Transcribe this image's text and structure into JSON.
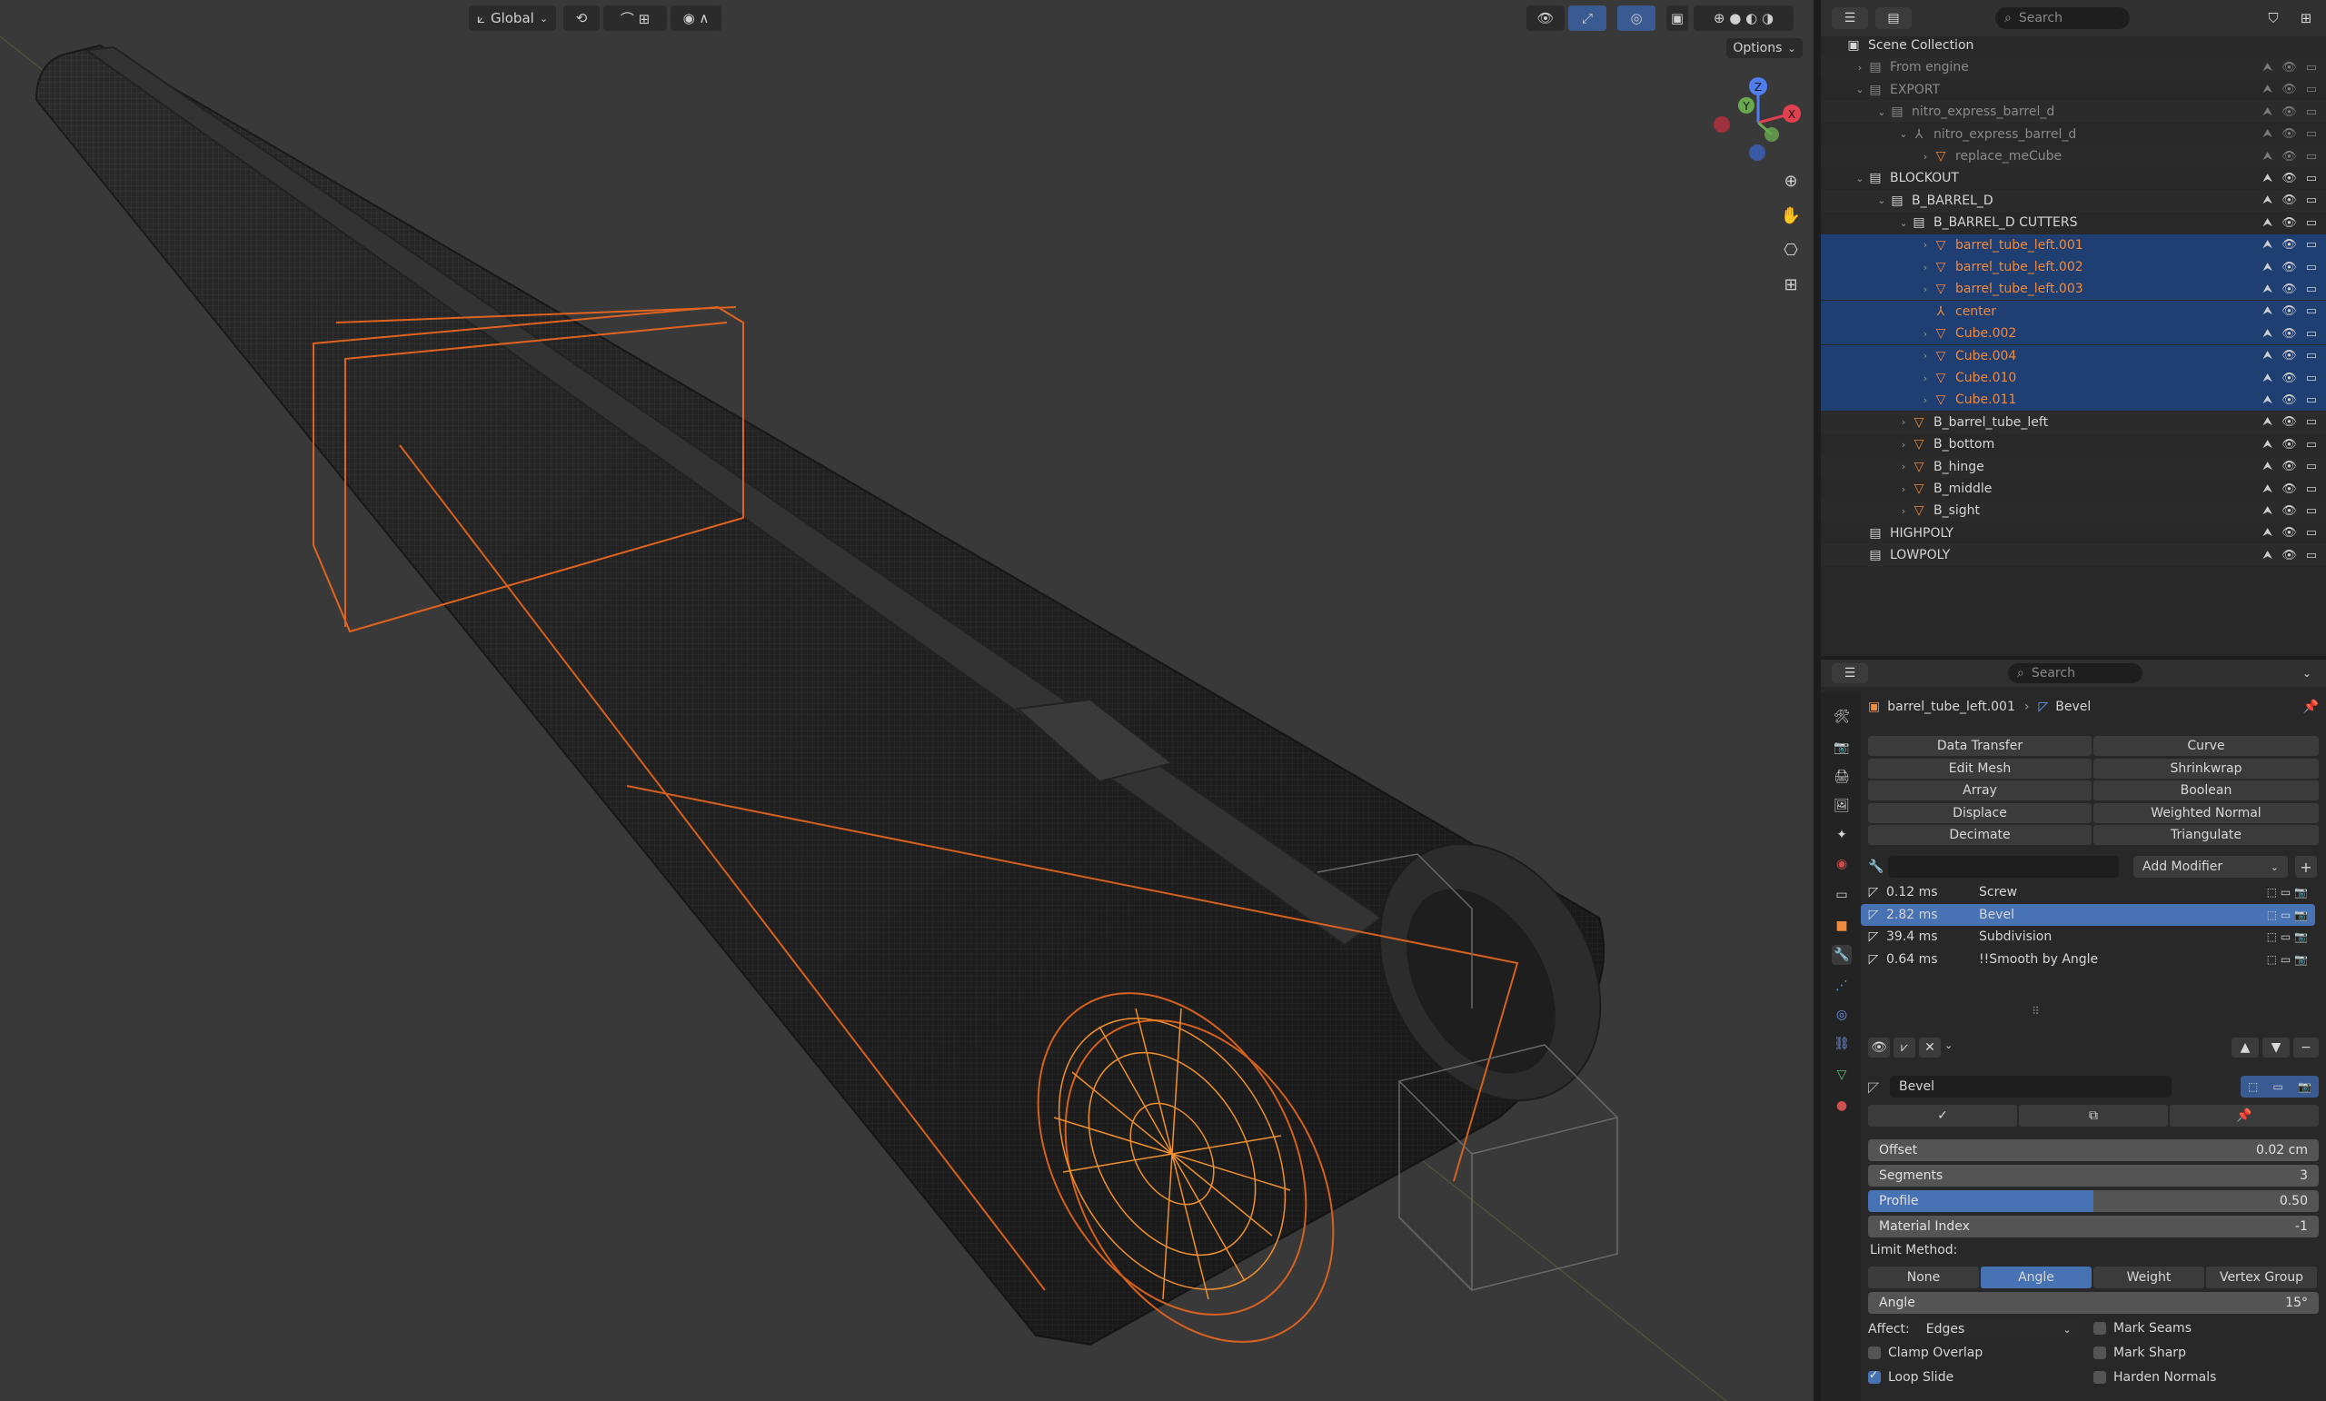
{
  "viewport_header": {
    "transform_orientation": "Global",
    "options_label": "Options"
  },
  "gizmo": {
    "x": "X",
    "y": "Y",
    "z": "Z"
  },
  "outliner": {
    "search_placeholder": "Search",
    "rows": [
      {
        "label": "Scene Collection",
        "indent": 0,
        "icon": "scene-collection-icon",
        "color": "#d6d6d6",
        "sel": false,
        "tri": ""
      },
      {
        "label": "From engine",
        "indent": 1,
        "icon": "collection-icon",
        "color": "#8a8a8a",
        "sel": false,
        "tri": "›"
      },
      {
        "label": "EXPORT",
        "indent": 1,
        "icon": "collection-icon",
        "color": "#8a8a8a",
        "sel": false,
        "tri": "⌄"
      },
      {
        "label": "nitro_express_barrel_d",
        "indent": 2,
        "icon": "collection-icon",
        "color": "#8a8a8a",
        "sel": false,
        "tri": "⌄"
      },
      {
        "label": "nitro_express_barrel_d",
        "indent": 3,
        "icon": "empty-icon",
        "color": "#8a8a8a",
        "sel": false,
        "tri": "⌄"
      },
      {
        "label": "replace_meCube",
        "indent": 4,
        "icon": "mesh-icon",
        "color": "#8a8a8a",
        "sel": false,
        "tri": "›"
      },
      {
        "label": "BLOCKOUT",
        "indent": 1,
        "icon": "collection-icon",
        "color": "#d6d6d6",
        "sel": false,
        "tri": "⌄"
      },
      {
        "label": "B_BARREL_D",
        "indent": 2,
        "icon": "collection-icon",
        "color": "#d6d6d6",
        "sel": false,
        "tri": "⌄"
      },
      {
        "label": "B_BARREL_D CUTTERS",
        "indent": 3,
        "icon": "collection-icon",
        "color": "#d6d6d6",
        "sel": false,
        "tri": "⌄"
      },
      {
        "label": "barrel_tube_left.001",
        "indent": 4,
        "icon": "mesh-icon",
        "color": "#f08a3c",
        "sel": true,
        "tri": "›"
      },
      {
        "label": "barrel_tube_left.002",
        "indent": 4,
        "icon": "mesh-icon",
        "color": "#f08a3c",
        "sel": true,
        "tri": "›"
      },
      {
        "label": "barrel_tube_left.003",
        "indent": 4,
        "icon": "mesh-icon",
        "color": "#f08a3c",
        "sel": true,
        "tri": "›"
      },
      {
        "label": "center",
        "indent": 4,
        "icon": "empty-icon",
        "color": "#f08a3c",
        "sel": true,
        "tri": ""
      },
      {
        "label": "Cube.002",
        "indent": 4,
        "icon": "mesh-icon",
        "color": "#f08a3c",
        "sel": true,
        "tri": "›"
      },
      {
        "label": "Cube.004",
        "indent": 4,
        "icon": "mesh-icon",
        "color": "#f08a3c",
        "sel": true,
        "tri": "›"
      },
      {
        "label": "Cube.010",
        "indent": 4,
        "icon": "mesh-icon",
        "color": "#f08a3c",
        "sel": true,
        "tri": "›"
      },
      {
        "label": "Cube.011",
        "indent": 4,
        "icon": "mesh-icon",
        "color": "#f08a3c",
        "sel": true,
        "tri": "›"
      },
      {
        "label": "B_barrel_tube_left",
        "indent": 3,
        "icon": "mesh-icon",
        "color": "#d6d6d6",
        "sel": false,
        "tri": "›"
      },
      {
        "label": "B_bottom",
        "indent": 3,
        "icon": "mesh-icon",
        "color": "#d6d6d6",
        "sel": false,
        "tri": "›"
      },
      {
        "label": "B_hinge",
        "indent": 3,
        "icon": "mesh-icon",
        "color": "#d6d6d6",
        "sel": false,
        "tri": "›"
      },
      {
        "label": "B_middle",
        "indent": 3,
        "icon": "mesh-icon",
        "color": "#d6d6d6",
        "sel": false,
        "tri": "›"
      },
      {
        "label": "B_sight",
        "indent": 3,
        "icon": "mesh-icon",
        "color": "#d6d6d6",
        "sel": false,
        "tri": "›"
      },
      {
        "label": "HIGHPOLY",
        "indent": 1,
        "icon": "collection-icon",
        "color": "#d6d6d6",
        "sel": false,
        "tri": ""
      },
      {
        "label": "LOWPOLY",
        "indent": 1,
        "icon": "collection-icon",
        "color": "#d6d6d6",
        "sel": false,
        "tri": ""
      }
    ]
  },
  "properties": {
    "search_placeholder": "Search",
    "breadcrumb_object": "barrel_tube_left.001",
    "breadcrumb_modifier": "Bevel",
    "quick_modifiers_left": [
      "Data Transfer",
      "Edit Mesh",
      "Array",
      "Displace",
      "Decimate"
    ],
    "quick_modifiers_right": [
      "Curve",
      "Shrinkwrap",
      "Boolean",
      "Weighted Normal",
      "Triangulate"
    ],
    "add_modifier": "Add Modifier",
    "stack": [
      {
        "time": "0.12 ms",
        "name": "Screw",
        "active": false
      },
      {
        "time": "2.82 ms",
        "name": "Bevel",
        "active": true
      },
      {
        "time": "39.4 ms",
        "name": "Subdivision",
        "active": false
      },
      {
        "time": "0.64 ms",
        "name": "!!Smooth by Angle",
        "active": false
      }
    ],
    "modifier_name": "Bevel",
    "offset_label": "Offset",
    "offset_value": "0.02 cm",
    "segments_label": "Segments",
    "segments_value": "3",
    "profile_label": "Profile",
    "profile_value": "0.50",
    "profile_fraction": 0.5,
    "material_label": "Material Index",
    "material_value": "-1",
    "limit_method_label": "Limit Method:",
    "limit_methods": [
      "None",
      "Angle",
      "Weight",
      "Vertex Group"
    ],
    "limit_active": "Angle",
    "angle_label": "Angle",
    "angle_value": "15°",
    "affect_label": "Affect:",
    "affect_value": "Edges",
    "mark_seams": "Mark Seams",
    "clamp_overlap": "Clamp Overlap",
    "mark_sharp": "Mark Sharp",
    "loop_slide": "Loop Slide",
    "harden_normals": "Harden Normals"
  }
}
